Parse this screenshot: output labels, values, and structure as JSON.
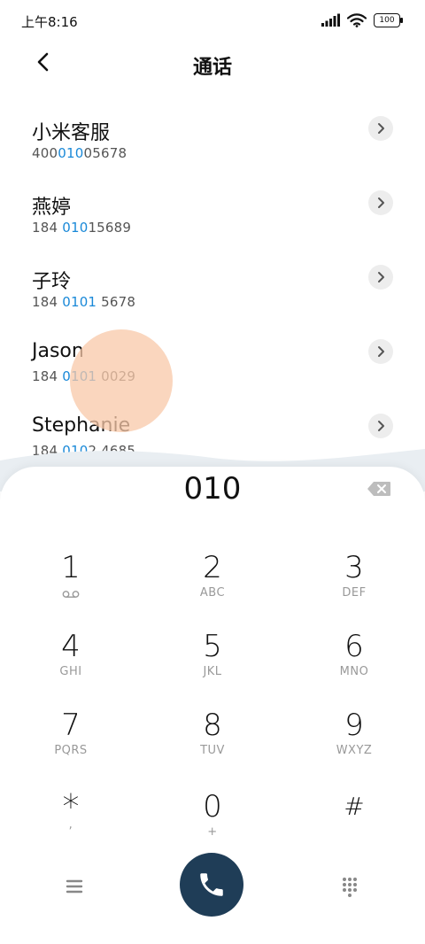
{
  "status_bar": {
    "time": "上午8:16",
    "battery": "100"
  },
  "header": {
    "title": "通话"
  },
  "contacts": [
    {
      "name": "小米客服",
      "number_pre": "400",
      "number_hl": "010",
      "number_post": "05678"
    },
    {
      "name": "燕婷",
      "number_pre": "184 ",
      "number_hl": "010",
      "number_post": "15689"
    },
    {
      "name": "子玲",
      "number_pre": "184 ",
      "number_hl": "0101",
      "number_post": " 5678"
    },
    {
      "name": "Jason",
      "number_pre": "184 ",
      "number_hl": "0101",
      "number_post": " 0029"
    },
    {
      "name": "Stephanie",
      "number_pre": "184 ",
      "number_hl": "010",
      "number_post": "2 4685"
    }
  ],
  "dialpad": {
    "dialed": "010",
    "keys": [
      {
        "digit": "1",
        "letters": ""
      },
      {
        "digit": "2",
        "letters": "ABC"
      },
      {
        "digit": "3",
        "letters": "DEF"
      },
      {
        "digit": "4",
        "letters": "GHI"
      },
      {
        "digit": "5",
        "letters": "JKL"
      },
      {
        "digit": "6",
        "letters": "MNO"
      },
      {
        "digit": "7",
        "letters": "PQRS"
      },
      {
        "digit": "8",
        "letters": "TUV"
      },
      {
        "digit": "9",
        "letters": "WXYZ"
      },
      {
        "digit": "*",
        "letters": ","
      },
      {
        "digit": "0",
        "letters": "+"
      },
      {
        "digit": "#",
        "letters": ""
      }
    ]
  },
  "colors": {
    "highlight": "#1a89d8",
    "call_button": "#1f3d57"
  },
  "icons": [
    "back-icon",
    "chevron-right-icon",
    "backspace-icon",
    "voicemail-icon",
    "menu-icon",
    "dialpad-icon",
    "phone-icon",
    "signal-icon",
    "wifi-icon",
    "battery-icon"
  ]
}
